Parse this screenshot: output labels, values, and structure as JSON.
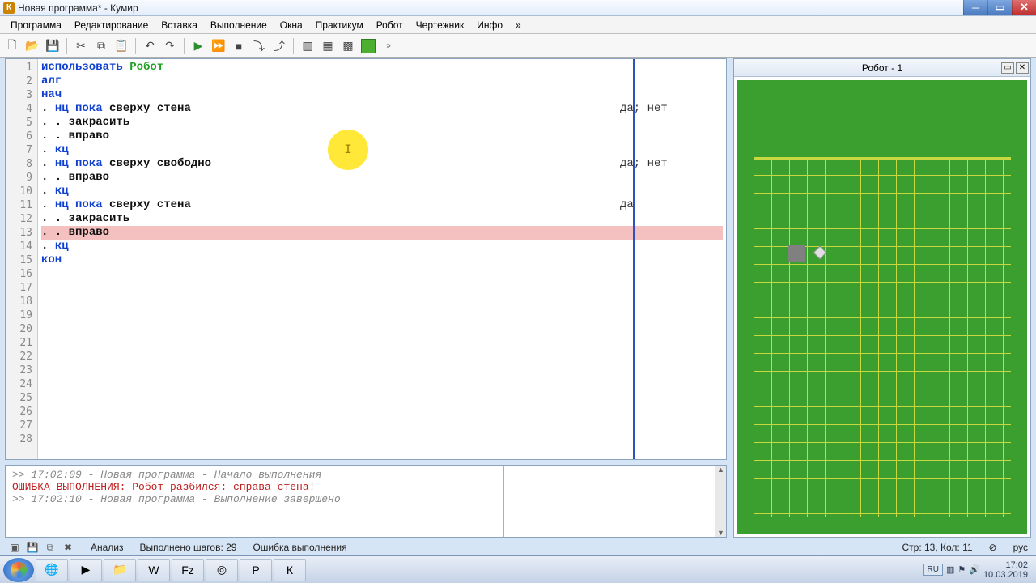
{
  "window": {
    "title": "Новая программа* - Кумир",
    "app_icon_letter": "К"
  },
  "menu": {
    "items": [
      "Программа",
      "Редактирование",
      "Вставка",
      "Выполнение",
      "Окна",
      "Практикум",
      "Робот",
      "Чертежник",
      "Инфо",
      "»"
    ]
  },
  "editor": {
    "total_lines": 28,
    "lines": [
      {
        "n": 1,
        "segments": [
          {
            "t": "использовать ",
            "c": "kw-blue"
          },
          {
            "t": "Робот",
            "c": "kw-green"
          }
        ]
      },
      {
        "n": 2,
        "segments": [
          {
            "t": "алг",
            "c": "kw-blue"
          }
        ]
      },
      {
        "n": 3,
        "segments": [
          {
            "t": "нач",
            "c": "kw-blue"
          }
        ]
      },
      {
        "n": 4,
        "segments": [
          {
            "t": ". ",
            "c": "kw-dark"
          },
          {
            "t": "нц пока ",
            "c": "kw-blue"
          },
          {
            "t": "сверху стена",
            "c": "kw-dark"
          }
        ],
        "margin": "да; нет"
      },
      {
        "n": 5,
        "segments": [
          {
            "t": ". . ",
            "c": "kw-dark"
          },
          {
            "t": "закрасить",
            "c": "kw-dark"
          }
        ]
      },
      {
        "n": 6,
        "segments": [
          {
            "t": ". . ",
            "c": "kw-dark"
          },
          {
            "t": "вправо",
            "c": "kw-dark"
          }
        ]
      },
      {
        "n": 7,
        "segments": [
          {
            "t": ". ",
            "c": "kw-dark"
          },
          {
            "t": "кц",
            "c": "kw-blue"
          }
        ]
      },
      {
        "n": 8,
        "segments": [
          {
            "t": ". ",
            "c": "kw-dark"
          },
          {
            "t": "нц пока ",
            "c": "kw-blue"
          },
          {
            "t": "сверху свободно",
            "c": "kw-dark"
          }
        ],
        "margin": "да; нет"
      },
      {
        "n": 9,
        "segments": [
          {
            "t": ". . ",
            "c": "kw-dark"
          },
          {
            "t": "вправо",
            "c": "kw-dark"
          }
        ]
      },
      {
        "n": 10,
        "segments": [
          {
            "t": ". ",
            "c": "kw-dark"
          },
          {
            "t": "кц",
            "c": "kw-blue"
          }
        ]
      },
      {
        "n": 11,
        "segments": [
          {
            "t": ". ",
            "c": "kw-dark"
          },
          {
            "t": "нц пока ",
            "c": "kw-blue"
          },
          {
            "t": "сверху стена",
            "c": "kw-dark"
          }
        ],
        "margin": "да"
      },
      {
        "n": 12,
        "segments": [
          {
            "t": ". . ",
            "c": "kw-dark"
          },
          {
            "t": "закрасить",
            "c": "kw-dark"
          }
        ]
      },
      {
        "n": 13,
        "segments": [
          {
            "t": ". . ",
            "c": "kw-dark"
          },
          {
            "t": "вправо",
            "c": "kw-dark"
          }
        ],
        "hl": true
      },
      {
        "n": 14,
        "segments": [
          {
            "t": ". ",
            "c": "kw-dark"
          },
          {
            "t": "кц",
            "c": "kw-blue"
          }
        ]
      },
      {
        "n": 15,
        "segments": [
          {
            "t": "кон",
            "c": "kw-blue"
          }
        ]
      },
      {
        "n": 16,
        "segments": []
      }
    ]
  },
  "console": {
    "lines": [
      {
        "t": ">> 17:02:09 - Новая программа - Начало выполнения",
        "cls": ""
      },
      {
        "t": "ОШИБКА ВЫПОЛНЕНИЯ: Робот разбился: справа стена!",
        "cls": "err"
      },
      {
        "t": ">> 17:02:10 - Новая программа - Выполнение завершено",
        "cls": ""
      }
    ]
  },
  "robot": {
    "title": "Робот - 1"
  },
  "status": {
    "analysis": "Анализ",
    "steps": "Выполнено шагов: 29",
    "error": "Ошибка выполнения",
    "cursor": "Стр: 13, Кол: 11",
    "ovr": "⊘",
    "lang": "рус"
  },
  "taskbar": {
    "apps": [
      "🌐",
      "▶",
      "📁",
      "W",
      "Fz",
      "◎",
      "P",
      "К"
    ],
    "lang": "RU",
    "time": "17:02",
    "date": "10.03.2019"
  }
}
